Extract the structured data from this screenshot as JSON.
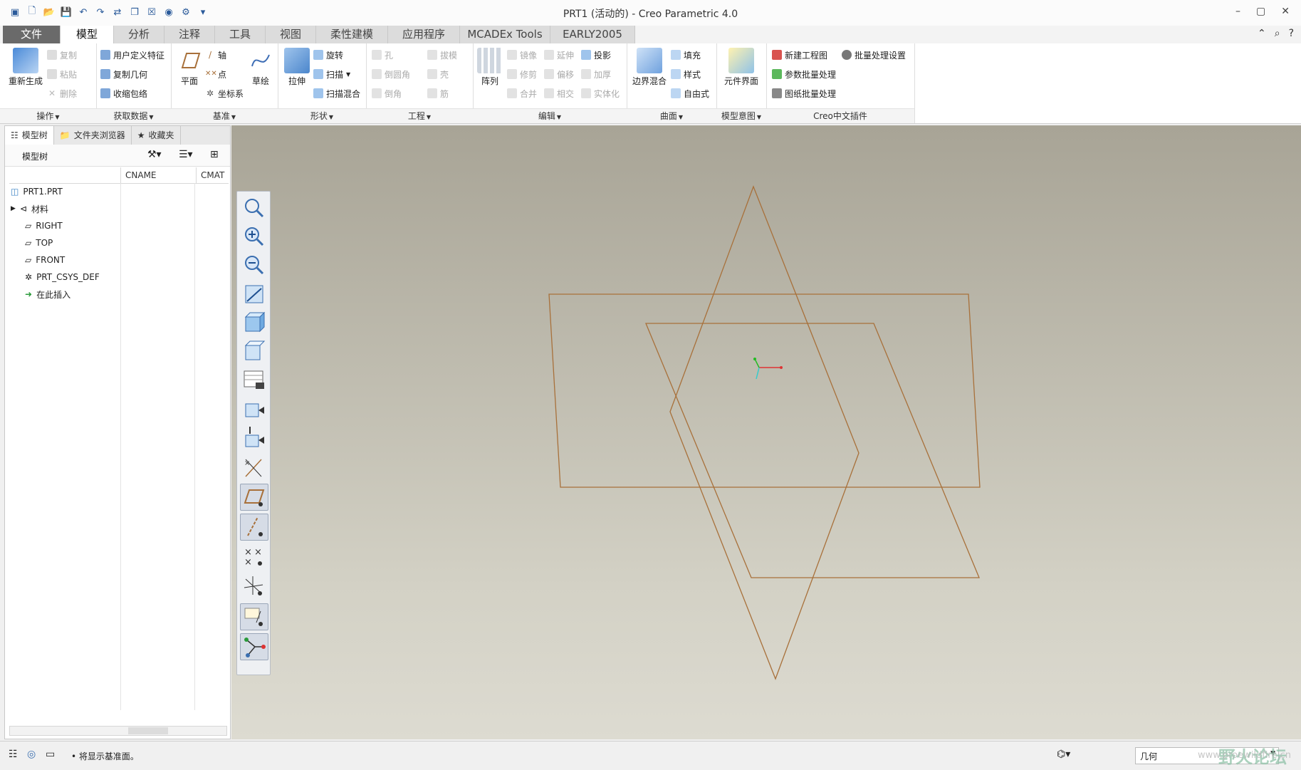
{
  "window": {
    "title": "PRT1 (活动的) - Creo Parametric 4.0"
  },
  "tabs": [
    "文件",
    "模型",
    "分析",
    "注释",
    "工具",
    "视图",
    "柔性建模",
    "应用程序",
    "MCADEx Tools",
    "EARLY2005"
  ],
  "active_tab": "模型",
  "ribbon": {
    "ops": {
      "label": "操作",
      "regen": "重新生成",
      "copy": "复制",
      "paste": "粘贴",
      "delete": "删除"
    },
    "getdata": {
      "label": "获取数据",
      "udf": "用户定义特征",
      "copygeom": "复制几何",
      "shrinkwrap": "收缩包络"
    },
    "datum": {
      "label": "基准",
      "plane": "平面",
      "axis": "轴",
      "point": "点",
      "csys": "坐标系",
      "sketch": "草绘"
    },
    "shapes": {
      "label": "形状",
      "extrude": "拉伸",
      "revolve": "旋转",
      "sweep": "扫描",
      "sweepblend": "扫描混合"
    },
    "eng": {
      "label": "工程",
      "hole": "孔",
      "round": "倒圆角",
      "chamfer": "倒角",
      "draft": "拔模",
      "shell": "壳",
      "rib": "筋"
    },
    "edit": {
      "label": "编辑",
      "pattern": "阵列",
      "mirror": "镜像",
      "trim": "修剪",
      "merge": "合并",
      "extend": "延伸",
      "offset": "偏移",
      "intersect": "相交",
      "project": "投影",
      "thicken": "加厚",
      "solidify": "实体化"
    },
    "surfaces": {
      "label": "曲面",
      "boundary": "边界混合",
      "fill": "填充",
      "style": "样式",
      "freestyle": "自由式"
    },
    "intent": {
      "label": "模型意图",
      "interface": "元件界面"
    },
    "plugin": {
      "label": "Creo中文插件",
      "newdrawing": "新建工程图",
      "batchsetting": "批量处理设置",
      "parambatch": "参数批量处理",
      "drawingbatch": "图纸批量处理"
    }
  },
  "navtabs": [
    "模型树",
    "文件夹浏览器",
    "收藏夹"
  ],
  "tree": {
    "header": "模型树",
    "columns": [
      "CNAME",
      "CMAT"
    ],
    "items": [
      "PRT1.PRT",
      "材料",
      "RIGHT",
      "TOP",
      "FRONT",
      "PRT_CSYS_DEF",
      "在此插入"
    ]
  },
  "status": {
    "message": "• 将显示基准面。",
    "filter": "几何"
  },
  "watermark": {
    "text": "野火论坛",
    "url": "www.proewildfire.cn"
  },
  "colors": {
    "datum_plane": "#a8703a",
    "file_tab": "#6a6a6a"
  }
}
